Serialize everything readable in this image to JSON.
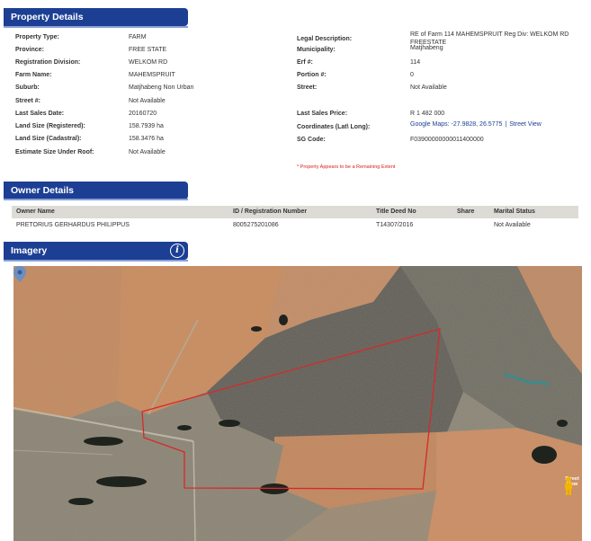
{
  "sections": {
    "property": "Property Details",
    "owner": "Owner Details",
    "imagery": "Imagery"
  },
  "property_left": [
    {
      "label": "Property Type:",
      "value": "FARM"
    },
    {
      "label": "Province:",
      "value": "FREE STATE"
    },
    {
      "label": "Registration Division:",
      "value": "WELKOM RD"
    },
    {
      "label": "Farm Name:",
      "value": "MAHEMSPRUIT"
    },
    {
      "label": "Suburb:",
      "value": "Matjhabeng Non Urban"
    },
    {
      "label": "Street #:",
      "value": "Not Available"
    },
    {
      "label": "Last Sales Date:",
      "value": "20160720"
    },
    {
      "label": "Land Size (Registered):",
      "value": "158.7939 ha"
    },
    {
      "label": "Land Size (Cadastral):",
      "value": "158.3476 ha"
    },
    {
      "label": "Estimate Size Under Roof:",
      "value": "Not Available"
    }
  ],
  "property_right": {
    "legal": {
      "label": "Legal Description:",
      "value": "RE of Farm 114 MAHEMSPRUIT Reg Div: WELKOM RD FREESTATE"
    },
    "municipality": {
      "label": "Municipality:",
      "value": "Matjhabeng"
    },
    "erf": {
      "label": "Erf #:",
      "value": "114"
    },
    "portion": {
      "label": "Portion #:",
      "value": "0"
    },
    "street": {
      "label": "Street:",
      "value": "Not Available"
    },
    "price": {
      "label": "Last Sales Price:",
      "value": "R 1 482 000"
    },
    "coords": {
      "label": "Coordinates (Lat\\ Long):",
      "value": "Google Maps: -27.9828, 26.5775",
      "separator": "|",
      "link": "Street View"
    },
    "sg": {
      "label": "SG Code:",
      "value": "F03900000000011400000"
    }
  },
  "note": "* Property Appears to be a Remaining Extent",
  "owner_table": {
    "headers": [
      "Owner Name",
      "ID / Registration Number",
      "Title Deed No",
      "Share",
      "Marital Status"
    ],
    "rows": [
      [
        "PRETORIUS GERHARDUS PHILIPPUS",
        "8005275201086",
        "T14307/2016",
        "",
        "Not Available"
      ]
    ]
  },
  "imagery": {
    "info_icon": "info-icon",
    "street_view_label": "Street View"
  },
  "colors": {
    "accent": "#1c3f94",
    "note": "#d92020",
    "boundary": "#d62a2a",
    "table_header": "#dddbd6"
  }
}
